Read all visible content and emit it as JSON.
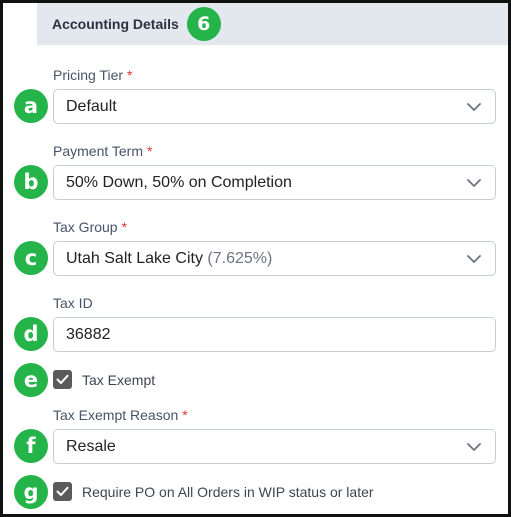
{
  "section": {
    "title": "Accounting Details",
    "badge": "6"
  },
  "fields": {
    "pricing_tier": {
      "badge": "a",
      "label": "Pricing Tier",
      "required": "*",
      "value": "Default"
    },
    "payment_term": {
      "badge": "b",
      "label": "Payment Term",
      "required": "*",
      "value": "50% Down, 50% on Completion"
    },
    "tax_group": {
      "badge": "c",
      "label": "Tax Group",
      "required": "*",
      "value": "Utah Salt Lake City",
      "value_suffix": "(7.625%)"
    },
    "tax_id": {
      "badge": "d",
      "label": "Tax ID",
      "value": "36882"
    },
    "tax_exempt": {
      "badge": "e",
      "label": "Tax Exempt",
      "checked": true
    },
    "tax_exempt_reason": {
      "badge": "f",
      "label": "Tax Exempt Reason",
      "required": "*",
      "value": "Resale"
    },
    "require_po": {
      "badge": "g",
      "label": "Require PO on All Orders in WIP status or later",
      "checked": true
    }
  },
  "colors": {
    "badge_green": "#25b44a",
    "header_bg": "#e3e8ef",
    "required_red": "#e0312d",
    "checkbox_fill": "#5a5a5a"
  },
  "icons": {
    "dropdown": "chevron-down-icon",
    "checkbox": "checkmark-icon"
  }
}
